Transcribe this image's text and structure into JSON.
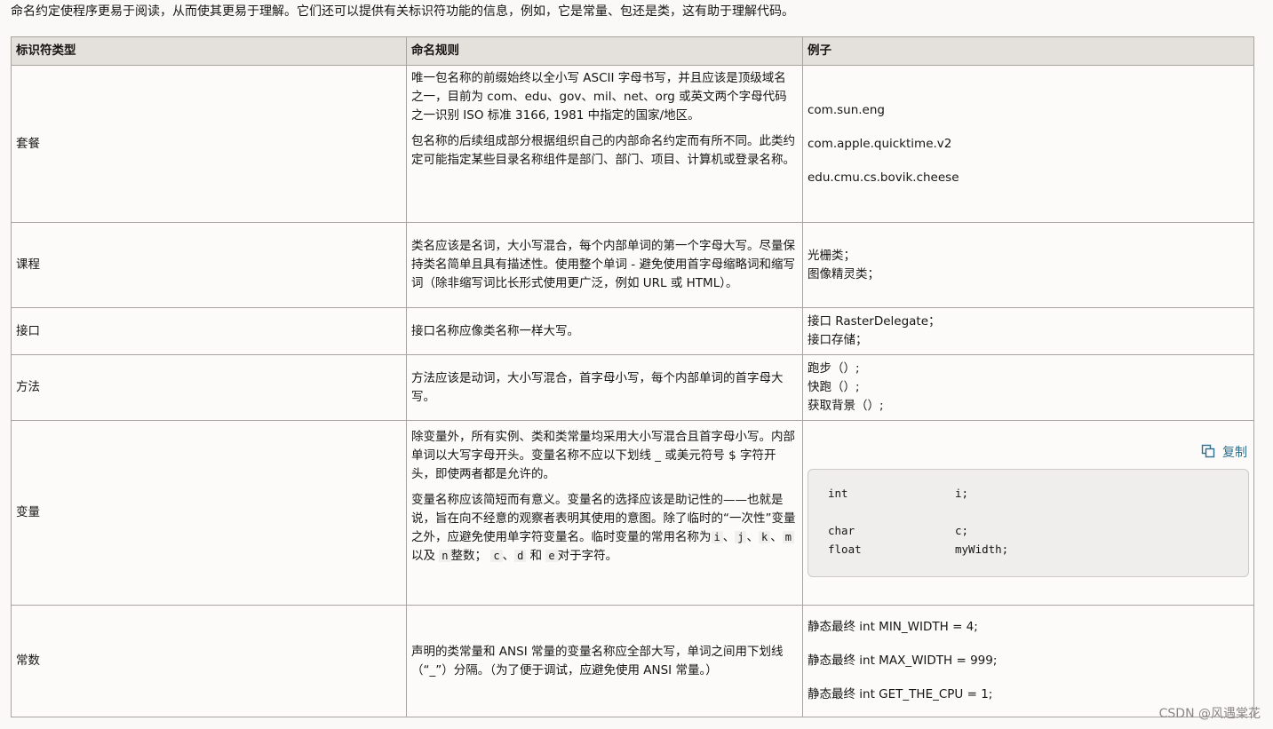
{
  "intro": "命名约定使程序更易于阅读，从而使其更易于理解。它们还可以提供有关标识符功能的信息，例如，它是常量、包还是类，这有助于理解代码。",
  "table": {
    "headers": [
      "标识符类型",
      "命名规则",
      "例子"
    ],
    "rows": {
      "packages": {
        "type": "套餐",
        "rule_p1": "唯一包名称的前缀始终以全小写 ASCII 字母书写，并且应该是顶级域名之一，目前为 com、edu、gov、mil、net、org 或英文两个字母代码之一识别 ISO 标准 3166, 1981 中指定的国家/地区。",
        "rule_p2": "包名称的后续组成部分根据组织自己的内部命名约定而有所不同。此类约定可能指定某些目录名称组件是部门、部门、项目、计算机或登录名称。",
        "examples": [
          "com.sun.eng",
          "com.apple.quicktime.v2",
          "edu.cmu.cs.bovik.cheese"
        ]
      },
      "classes": {
        "type": "课程",
        "rule": "类名应该是名词，大小写混合，每个内部单词的第一个字母大写。尽量保持类名简单且具有描述性。使用整个单词 - 避免使用首字母缩略词和缩写词（除非缩写词比长形式使用更广泛，例如 URL 或 HTML）。",
        "examples": [
          "光栅类；",
          "图像精灵类；"
        ]
      },
      "interfaces": {
        "type": "接口",
        "rule": "接口名称应像类名称一样大写。",
        "examples": [
          "接口 RasterDelegate；",
          "接口存储；"
        ]
      },
      "methods": {
        "type": "方法",
        "rule": "方法应该是动词，大小写混合，首字母小写，每个内部单词的首字母大写。",
        "examples": [
          "跑步（）;",
          "快跑（）;",
          "获取背景（）;"
        ]
      },
      "variables": {
        "type": "变量",
        "rule_p1": "除变量外，所有实例、类和类常量均采用大小写混合且首字母小写。内部单词以大写字母开头。变量名称不应以下划线 _ 或美元符号 $ 字符开头，即使两者都是允许的。",
        "rule_p2_prefix": "变量名称应该简短而有意义。变量名的选择应该是助记性的——也就是说，旨在向不经意的观察者表明其使用的意图。除了临时的“一次性”变量之外，应避免使用单字符变量名。临时变量的常用名称为",
        "vars": [
          "i",
          "j",
          "k",
          "m",
          "n",
          "c",
          "d",
          "e"
        ],
        "sep1": "、",
        "sep2": "、",
        "sep3": "、",
        "sep4": " 以及 ",
        "int_word": "整数；",
        "sep5": "、",
        "sep6": " 和 ",
        "char_word": "对于字符。",
        "copy_label": "复制",
        "code": [
          {
            "type": "int",
            "name": "i;"
          },
          {
            "type": "",
            "name": ""
          },
          {
            "type": "char",
            "name": "c;"
          },
          {
            "type": "float",
            "name": "myWidth;"
          }
        ]
      },
      "constants": {
        "type": "常数",
        "rule": "声明的类常量和 ANSI 常量的变量名称应全部大写，单词之间用下划线（“_”）分隔。（为了便于调试，应避免使用 ANSI 常量。）",
        "examples": [
          "静态最终 int MIN_WIDTH = 4;",
          "静态最终 int MAX_WIDTH = 999;",
          "静态最终 int GET_THE_CPU = 1;"
        ]
      }
    }
  },
  "watermark": "CSDN @风遇棠花",
  "colors": {
    "header_bg": "#e4e1dd",
    "border": "#a7a4a0",
    "link": "#2e6f8e",
    "code_bg": "#efeeed"
  },
  "icons": {
    "copy": "copy-icon"
  }
}
